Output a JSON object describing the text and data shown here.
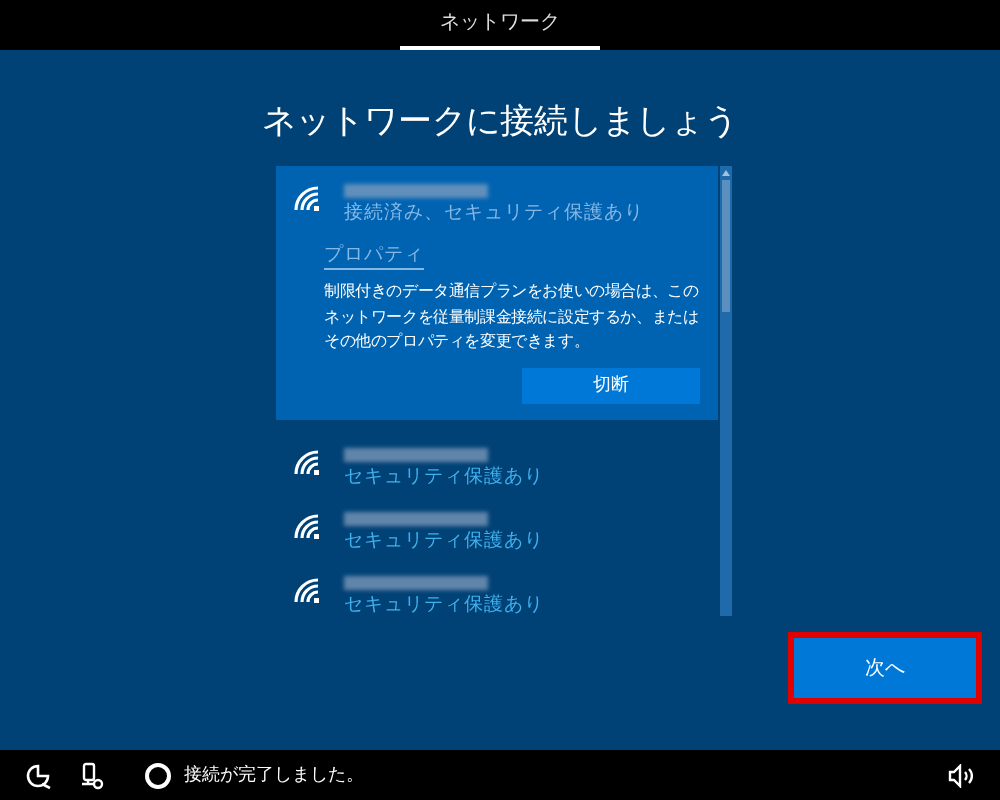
{
  "header": {
    "tabs": [
      {
        "label": "ネットワーク",
        "selected": true
      }
    ]
  },
  "title": "ネットワークに接続しましょう",
  "networks": [
    {
      "status": "接続済み、セキュリティ保護あり",
      "selected": true,
      "properties_link": "プロパティ",
      "description": "制限付きのデータ通信プランをお使いの場合は、このネットワークを従量制課金接続に設定するか、またはその他のプロパティを変更できます。",
      "action_button": "切断"
    },
    {
      "status": "セキュリティ保護あり",
      "selected": false
    },
    {
      "status": "セキュリティ保護あり",
      "selected": false
    },
    {
      "status": "セキュリティ保護あり",
      "selected": false
    }
  ],
  "next_button": {
    "label": "次へ",
    "highlighted": true
  },
  "taskbar": {
    "status_text": "接続が完了しました。"
  }
}
